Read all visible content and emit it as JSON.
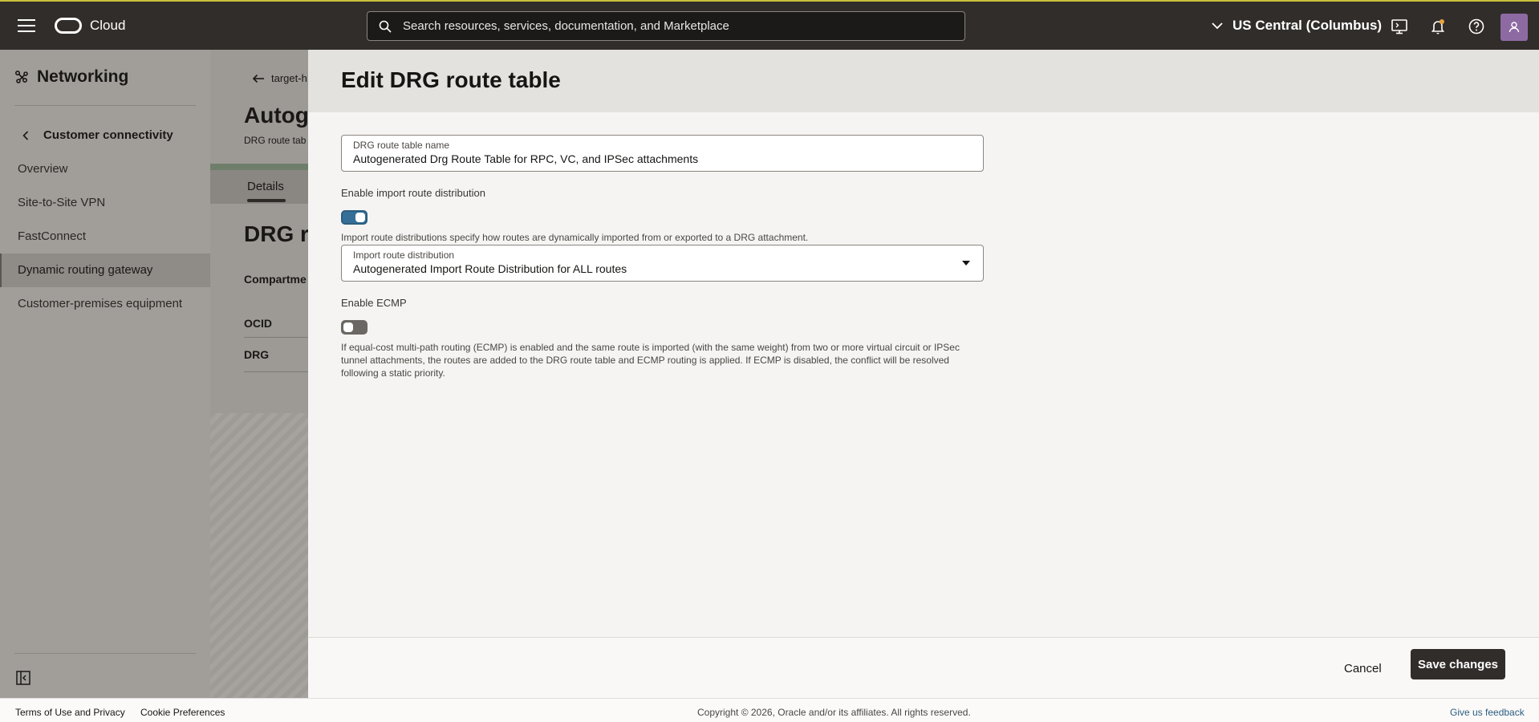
{
  "header": {
    "brand": "Cloud",
    "search_placeholder": "Search resources, services, documentation, and Marketplace",
    "region": "US Central (Columbus)"
  },
  "sidebar": {
    "title": "Networking",
    "back_label": "Customer connectivity",
    "items": [
      {
        "label": "Overview"
      },
      {
        "label": "Site-to-Site VPN"
      },
      {
        "label": "FastConnect"
      },
      {
        "label": "Dynamic routing gateway",
        "active": true
      },
      {
        "label": "Customer-premises equipment"
      }
    ]
  },
  "background_page": {
    "back_link": "target-h",
    "title": "Autog",
    "subtitle": "DRG route tab",
    "tab": "Details",
    "section_title": "DRG r",
    "fields": [
      "Compartme",
      "OCID",
      "DRG"
    ]
  },
  "panel": {
    "title": "Edit DRG route table",
    "name_field": {
      "label": "DRG route table name",
      "value": "Autogenerated Drg Route Table for RPC, VC, and IPSec attachments"
    },
    "import_toggle": {
      "label": "Enable import route distribution",
      "on": true,
      "help": "Import route distributions specify how routes are dynamically imported from or exported to a DRG attachment."
    },
    "import_select": {
      "label": "Import route distribution",
      "value": "Autogenerated Import Route Distribution for ALL routes"
    },
    "ecmp_toggle": {
      "label": "Enable ECMP",
      "on": false,
      "help": "If equal-cost multi-path routing (ECMP) is enabled and the same route is imported (with the same weight) from two or more virtual circuit or IPSec tunnel attachments, the routes are added to the DRG route table and ECMP routing is applied. If ECMP is disabled, the conflict will be resolved following a static priority."
    },
    "cancel_label": "Cancel",
    "save_label": "Save changes"
  },
  "footer": {
    "terms": "Terms of Use and Privacy",
    "cookies": "Cookie Preferences",
    "copyright": "Copyright © 2026, Oracle and/or its affiliates. All rights reserved.",
    "feedback": "Give us feedback"
  }
}
